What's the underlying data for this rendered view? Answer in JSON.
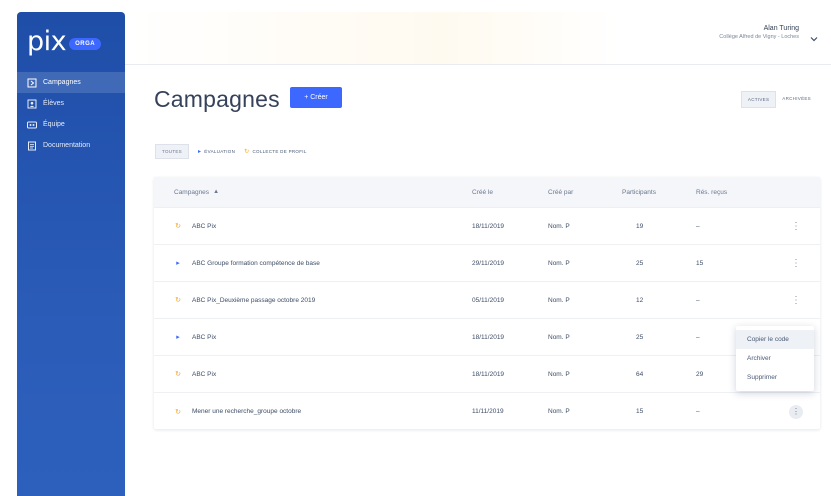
{
  "app": {
    "logo_text": "pix",
    "logo_badge": "ORGA"
  },
  "sidebar": {
    "items": [
      {
        "label": "Campagnes",
        "icon": "campaign-icon",
        "active": true
      },
      {
        "label": "Élèves",
        "icon": "students-icon",
        "active": false
      },
      {
        "label": "Équipe",
        "icon": "team-icon",
        "active": false
      },
      {
        "label": "Documentation",
        "icon": "documentation-icon",
        "active": false
      }
    ]
  },
  "header": {
    "user_name": "Alan Turing",
    "school": "Collège Alfred de Vigny - Loches"
  },
  "main": {
    "title": "Campagnes",
    "create_label": "+ Créer",
    "toggle": {
      "active": "ACTIVES",
      "archived": "ARCHIVÉES"
    },
    "filters": {
      "all": "TOUTES",
      "evaluation": "ÉVALUATION",
      "profile": "COLLECTE DE PROFIL"
    }
  },
  "table": {
    "headers": {
      "name": "Campagnes",
      "created_at": "Créé le",
      "created_by": "Créé par",
      "participants": "Participants",
      "results": "Rés. reçus"
    },
    "rows": [
      {
        "type": "profile",
        "name": "ABC Pix",
        "date": "18/11/2019",
        "by": "Nom. P",
        "participants": "19",
        "results": "–"
      },
      {
        "type": "evaluation",
        "name": "ABC Groupe formation compétence de base",
        "date": "29/11/2019",
        "by": "Nom. P",
        "participants": "25",
        "results": "15"
      },
      {
        "type": "profile",
        "name": "ABC Pix_Deuxième passage octobre 2019",
        "date": "05/11/2019",
        "by": "Nom. P",
        "participants": "12",
        "results": "–"
      },
      {
        "type": "evaluation",
        "name": "ABC Pix",
        "date": "18/11/2019",
        "by": "Nom. P",
        "participants": "25",
        "results": "–"
      },
      {
        "type": "profile",
        "name": "ABC Pix",
        "date": "18/11/2019",
        "by": "Nom. P",
        "participants": "64",
        "results": "29"
      },
      {
        "type": "profile",
        "name": "Mener une recherche_groupe octobre",
        "date": "11/11/2019",
        "by": "Nom. P",
        "participants": "15",
        "results": "–"
      }
    ]
  },
  "dropdown": {
    "items": [
      "Copier le code",
      "Archiver",
      "Supprimer"
    ]
  },
  "colors": {
    "sidebar": "#1e4ea8",
    "accent": "#3d68ff",
    "profile": "#f5a623"
  }
}
